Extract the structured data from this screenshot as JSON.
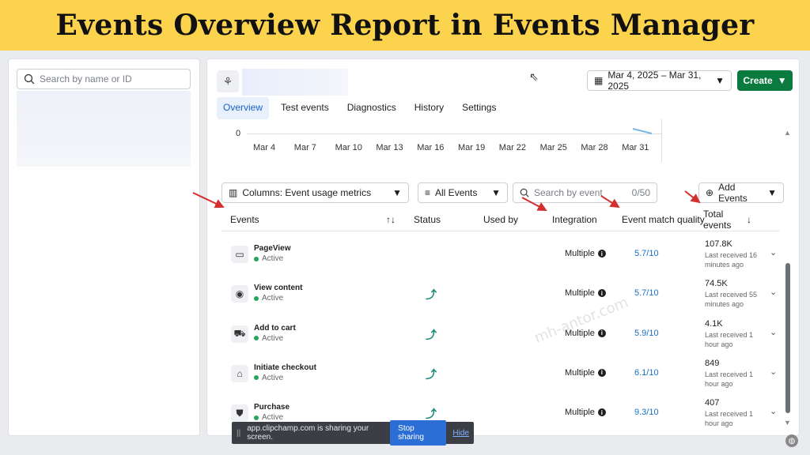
{
  "banner": {
    "title": "Events Overview Report in Events Manager"
  },
  "left": {
    "search_placeholder": "Search by name or ID"
  },
  "header": {
    "date_range": "Mar 4, 2025 – Mar 31, 2025",
    "create_label": "Create"
  },
  "tabs": [
    {
      "label": "Overview",
      "active": true
    },
    {
      "label": "Test events"
    },
    {
      "label": "Diagnostics"
    },
    {
      "label": "History"
    },
    {
      "label": "Settings"
    }
  ],
  "chart_data": {
    "type": "line",
    "y_tick": "0",
    "categories": [
      "Mar 4",
      "Mar 7",
      "Mar 10",
      "Mar 13",
      "Mar 16",
      "Mar 19",
      "Mar 22",
      "Mar 25",
      "Mar 28",
      "Mar 31"
    ]
  },
  "controls": {
    "columns_label": "Columns: Event usage metrics",
    "filter_label": "All Events",
    "search_placeholder": "Search by event",
    "search_count": "0/50",
    "add_events_label": "Add Events"
  },
  "table": {
    "headers": {
      "events": "Events",
      "sort_icon": "↑↓",
      "status": "Status",
      "used_by": "Used by",
      "integration": "Integration",
      "emq": "Event match quality",
      "total_line1": "Total",
      "total_line2": "events",
      "total_sort": "↓"
    },
    "rows": [
      {
        "name": "PageView",
        "state": "Active",
        "icon": "browser-window-icon",
        "glyph": "▭",
        "status_icon": "",
        "integration": "Multiple",
        "emq": "5.7/10",
        "total": "107.8K",
        "last": "Last received 16 minutes ago"
      },
      {
        "name": "View content",
        "state": "Active",
        "icon": "eye-icon",
        "glyph": "◉",
        "status_icon": "⤴",
        "integration": "Multiple",
        "emq": "5.7/10",
        "total": "74.5K",
        "last": "Last received 55 minutes ago"
      },
      {
        "name": "Add to cart",
        "state": "Active",
        "icon": "cart-icon",
        "glyph": "⛟",
        "status_icon": "⤴",
        "integration": "Multiple",
        "emq": "5.9/10",
        "total": "4.1K",
        "last": "Last received 1 hour ago"
      },
      {
        "name": "Initiate checkout",
        "state": "Active",
        "icon": "basket-icon",
        "glyph": "⌂",
        "status_icon": "⤴",
        "integration": "Multiple",
        "emq": "6.1/10",
        "total": "849",
        "last": "Last received 1 hour ago"
      },
      {
        "name": "Purchase",
        "state": "Active",
        "icon": "shopping-bag-icon",
        "glyph": "⛊",
        "status_icon": "⤴",
        "integration": "Multiple",
        "emq": "9.3/10",
        "total": "407",
        "last": "Last received 1 hour ago"
      }
    ]
  },
  "watermark": "mh-antor.com",
  "share_bar": {
    "message": "app.clipchamp.com is sharing your screen.",
    "stop_label": "Stop sharing",
    "hide_label": "Hide"
  },
  "colors": {
    "banner": "#fcd34d",
    "create": "#0a7a3e",
    "accent": "#1763cf",
    "annotation_arrows": "#d32f2f"
  }
}
